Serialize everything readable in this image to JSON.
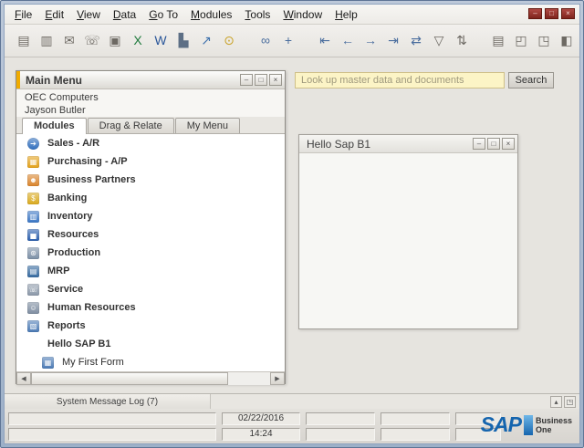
{
  "window_controls": {
    "minimize": "–",
    "restore": "□",
    "close": "×"
  },
  "menu_bar": {
    "items": [
      "File",
      "Edit",
      "View",
      "Data",
      "Go To",
      "Modules",
      "Tools",
      "Window",
      "Help"
    ]
  },
  "toolbar": {
    "groups": [
      {
        "name": "file-group",
        "align": "left",
        "icons": [
          {
            "name": "print-preview-icon",
            "glyph": "▤",
            "color": "#6d6963"
          },
          {
            "name": "print-icon",
            "glyph": "▥",
            "color": "#6d6963"
          },
          {
            "name": "email-icon",
            "glyph": "✉",
            "color": "#6d6963"
          },
          {
            "name": "sms-icon",
            "glyph": "☏",
            "color": "#6d6963"
          },
          {
            "name": "fax-icon",
            "glyph": "▣",
            "color": "#6d6963"
          },
          {
            "name": "export-excel-icon",
            "glyph": "X",
            "color": "#1f7a3d"
          },
          {
            "name": "export-word-icon",
            "glyph": "W",
            "color": "#2b579a"
          },
          {
            "name": "export-pdf-icon",
            "glyph": "▙",
            "color": "#5d6f85"
          },
          {
            "name": "launch-application-icon",
            "glyph": "↗",
            "color": "#3f72ad"
          },
          {
            "name": "lock-screen-icon",
            "glyph": "⊙",
            "color": "#c9a227"
          }
        ]
      },
      {
        "name": "find-group",
        "align": "left",
        "icons": [
          {
            "name": "find-icon",
            "glyph": "∞",
            "color": "#4b6e9e"
          },
          {
            "name": "add-record-icon",
            "glyph": "+",
            "color": "#4b6e9e"
          }
        ]
      },
      {
        "name": "navigation-group",
        "align": "left",
        "icons": [
          {
            "name": "first-record-icon",
            "glyph": "⇤",
            "color": "#4b6e9e"
          },
          {
            "name": "previous-record-icon",
            "glyph": "←",
            "color": "#4b6e9e"
          },
          {
            "name": "next-record-icon",
            "glyph": "→",
            "color": "#4b6e9e"
          },
          {
            "name": "last-record-icon",
            "glyph": "⇥",
            "color": "#4b6e9e"
          },
          {
            "name": "refresh-record-icon",
            "glyph": "⇄",
            "color": "#4b6e9e"
          },
          {
            "name": "filter-table-icon",
            "glyph": "▽",
            "color": "#6d6963"
          },
          {
            "name": "sort-table-icon",
            "glyph": "⇅",
            "color": "#6d6963"
          }
        ]
      },
      {
        "name": "tools-group",
        "align": "right",
        "icons": [
          {
            "name": "transaction-journal-icon",
            "glyph": "▤",
            "color": "#6d6963"
          },
          {
            "name": "base-document-icon",
            "glyph": "◰",
            "color": "#6d6963"
          },
          {
            "name": "target-document-icon",
            "glyph": "◳",
            "color": "#6d6963"
          },
          {
            "name": "payment-means-icon",
            "glyph": "◧",
            "color": "#6d6963"
          },
          {
            "name": "gross-profit-icon",
            "glyph": "%",
            "color": "#6d6963"
          },
          {
            "name": "settings-icon",
            "glyph": "⊞",
            "color": "#6d6963"
          },
          {
            "name": "pickers-display-icon",
            "glyph": "▦",
            "color": "#b07c28"
          }
        ]
      }
    ]
  },
  "search": {
    "placeholder": "Look up master data and documents",
    "button_label": "Search"
  },
  "main_menu": {
    "title": "Main Menu",
    "company": "OEC Computers",
    "user": "Jayson Butler",
    "tabs": [
      {
        "label": "Modules",
        "active": true
      },
      {
        "label": "Drag & Relate",
        "active": false
      },
      {
        "label": "My Menu",
        "active": false
      }
    ],
    "items": [
      {
        "label": "Sales - A/R",
        "icon": "sales-icon",
        "glyph": "➔",
        "color": "#2e6dbd",
        "shape": "circle",
        "bold": true,
        "indent": 0
      },
      {
        "label": "Purchasing - A/P",
        "icon": "purchasing-cart-icon",
        "glyph": "▦",
        "color": "#e3a11a",
        "bold": true,
        "indent": 0
      },
      {
        "label": "Business Partners",
        "icon": "business-partners-icon",
        "glyph": "☻",
        "color": "#d9842b",
        "bold": true,
        "indent": 0
      },
      {
        "label": "Banking",
        "icon": "banking-coins-icon",
        "glyph": "$",
        "color": "#d9a91c",
        "bold": true,
        "indent": 0
      },
      {
        "label": "Inventory",
        "icon": "inventory-icon",
        "glyph": "▥",
        "color": "#3a76c4",
        "bold": true,
        "indent": 0
      },
      {
        "label": "Resources",
        "icon": "resources-chart-icon",
        "glyph": "▅",
        "color": "#2b5fae",
        "bold": true,
        "indent": 0
      },
      {
        "label": "Production",
        "icon": "production-icon",
        "glyph": "⊛",
        "color": "#7b8fa6",
        "bold": true,
        "indent": 0
      },
      {
        "label": "MRP",
        "icon": "mrp-icon",
        "glyph": "▤",
        "color": "#35699f",
        "bold": true,
        "indent": 0
      },
      {
        "label": "Service",
        "icon": "service-icon",
        "glyph": "☏",
        "color": "#8a97a8",
        "bold": true,
        "indent": 0
      },
      {
        "label": "Human Resources",
        "icon": "human-resources-icon",
        "glyph": "☺",
        "color": "#7d8ca0",
        "bold": true,
        "indent": 0
      },
      {
        "label": "Reports",
        "icon": "reports-icon",
        "glyph": "▧",
        "color": "#4a7ab5",
        "bold": true,
        "indent": 0
      },
      {
        "label": "Hello SAP B1",
        "icon": null,
        "glyph": "",
        "color": "",
        "bold": true,
        "indent": 0
      },
      {
        "label": "My First Form",
        "icon": "form-icon",
        "glyph": "▦",
        "color": "#4a7ab5",
        "bold": false,
        "indent": 1
      }
    ],
    "scroll_left_glyph": "◀",
    "scroll_right_glyph": "▶"
  },
  "hello_window": {
    "title": "Hello Sap B1"
  },
  "message_log": {
    "label": "System Message Log (7)",
    "icons": [
      {
        "name": "expand-log-icon",
        "glyph": "▴"
      },
      {
        "name": "float-log-icon",
        "glyph": "◳"
      }
    ]
  },
  "status_bar": {
    "date": "02/22/2016",
    "time": "14:24"
  },
  "branding": {
    "sap": "SAP",
    "product_line1": "Business",
    "product_line2": "One"
  }
}
